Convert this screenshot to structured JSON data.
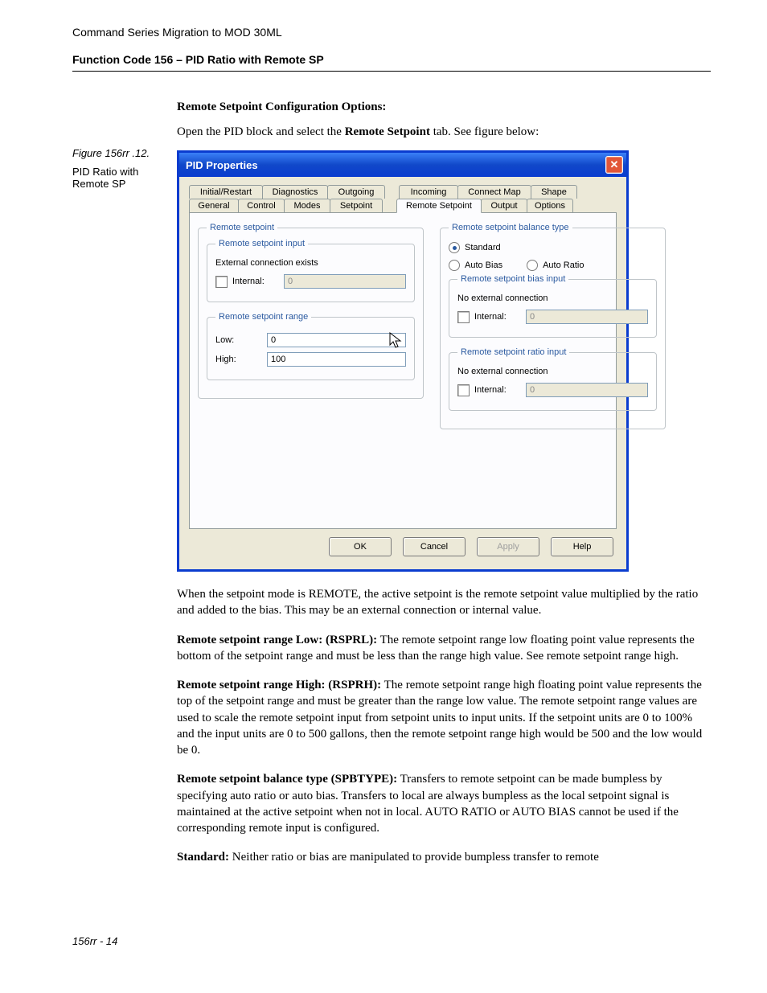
{
  "doc": {
    "header": "Command Series Migration to MOD 30ML",
    "subheader": "Function Code 156 – PID Ratio with Remote SP",
    "figure_label": "Figure 156rr .12.",
    "figure_caption": "PID Ratio with Remote SP",
    "section_title": "Remote Setpoint Configuration Options:",
    "intro_pre": "Open the PID block and select the ",
    "intro_bold": "Remote Setpoint",
    "intro_post": " tab. See figure below:",
    "footer": "156rr - 14"
  },
  "dialog": {
    "title": "PID Properties",
    "close": "✕",
    "tabs_row1": [
      "Initial/Restart",
      "Diagnostics",
      "Outgoing",
      "Incoming",
      "Connect Map",
      "Shape"
    ],
    "tabs_row2": [
      "General",
      "Control",
      "Modes",
      "Setpoint",
      "Remote Setpoint",
      "Output",
      "Options"
    ],
    "active_tab": "Remote Setpoint",
    "left": {
      "rsp_group": "Remote setpoint",
      "rsi_group": "Remote setpoint input",
      "rsi_note": "External connection exists",
      "internal_label": "Internal:",
      "internal_value": "0",
      "range_group": "Remote setpoint range",
      "low_label": "Low:",
      "low_value": "0",
      "high_label": "High:",
      "high_value": "100"
    },
    "right": {
      "bal_group": "Remote setpoint balance type",
      "opt_standard": "Standard",
      "opt_autobias": "Auto Bias",
      "opt_autoratio": "Auto Ratio",
      "bias_group": "Remote setpoint bias input",
      "noext": "No external connection",
      "internal_label": "Internal:",
      "bias_value": "0",
      "ratio_group": "Remote setpoint ratio input",
      "ratio_value": "0"
    },
    "buttons": {
      "ok": "OK",
      "cancel": "Cancel",
      "apply": "Apply",
      "help": "Help"
    }
  },
  "paras": {
    "p1": "When the setpoint mode is REMOTE, the active setpoint is the remote setpoint value multiplied by the ratio and added to the bias.  This may be an external connection or internal value.",
    "p2_b": "Remote setpoint range Low: (RSPRL):",
    "p2": " The remote setpoint range low floating point value represents the bottom of the setpoint range and must be less than the range high value.  See remote setpoint range high.",
    "p3_b": "Remote setpoint range High: (RSPRH):",
    "p3": " The remote setpoint range high floating point value represents the top of the setpoint range and must be greater than the range low value.  The remote setpoint range values are used to scale the remote setpoint input from setpoint units to input units.  If the setpoint units are 0 to 100% and the input units are 0 to 500 gallons, then the remote setpoint range high would be 500 and the low would be 0.",
    "p4_b": "Remote setpoint balance type (SPBTYPE):",
    "p4": " Transfers to remote setpoint can be made bumpless by specifying auto ratio or auto bias.  Transfers to local are always bumpless as the local setpoint signal is maintained at the active setpoint when not in local.  AUTO RATIO or AUTO BIAS cannot be used if the corresponding remote input is configured.",
    "p5_b": "Standard:",
    "p5": "  Neither ratio or bias are manipulated to provide bumpless transfer to remote"
  }
}
